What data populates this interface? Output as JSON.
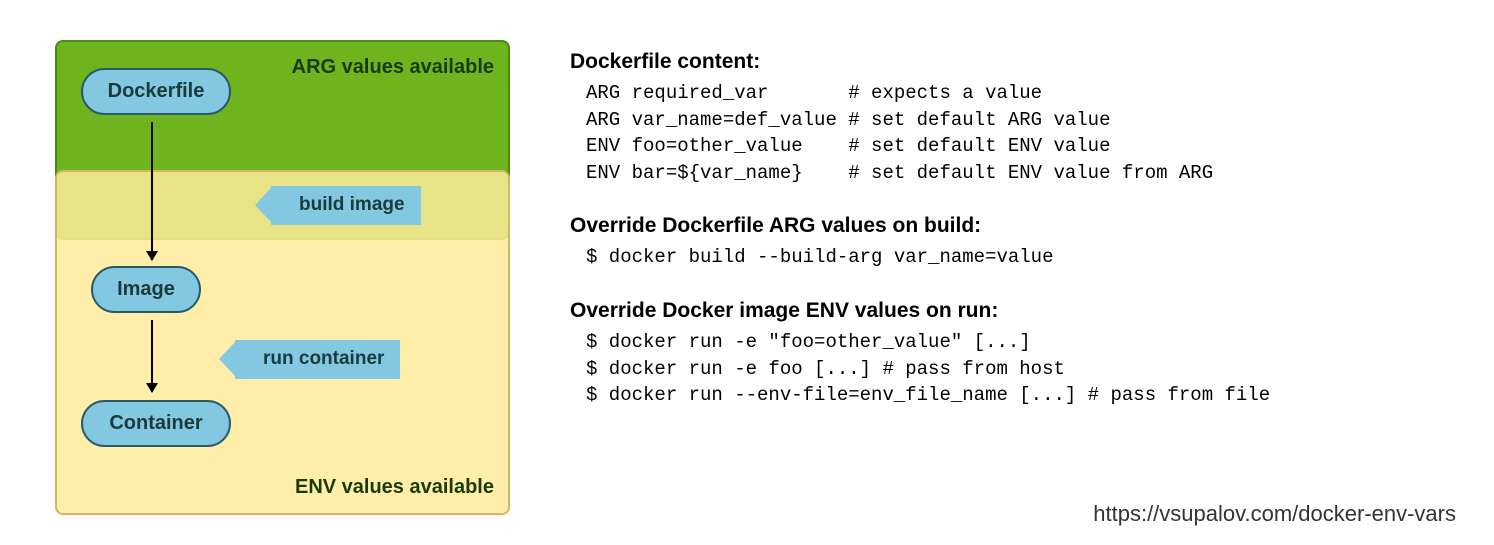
{
  "diagram": {
    "arg_label": "ARG values available",
    "env_label": "ENV values available",
    "pill_dockerfile": "Dockerfile",
    "pill_image": "Image",
    "pill_container": "Container",
    "tag_build": "build image",
    "tag_run": "run container"
  },
  "sections": {
    "dockerfile_title": "Dockerfile content:",
    "dockerfile_code": "ARG required_var       # expects a value\nARG var_name=def_value # set default ARG value\nENV foo=other_value    # set default ENV value\nENV bar=${var_name}    # set default ENV value from ARG",
    "override_build_title": "Override Dockerfile ARG values on build:",
    "override_build_code": "$ docker build --build-arg var_name=value",
    "override_run_title": "Override Docker image ENV values on run:",
    "override_run_code": "$ docker run -e \"foo=other_value\" [...]\n$ docker run -e foo [...] # pass from host\n$ docker run --env-file=env_file_name [...] # pass from file"
  },
  "footer": {
    "link": "https://vsupalov.com/docker-env-vars"
  }
}
